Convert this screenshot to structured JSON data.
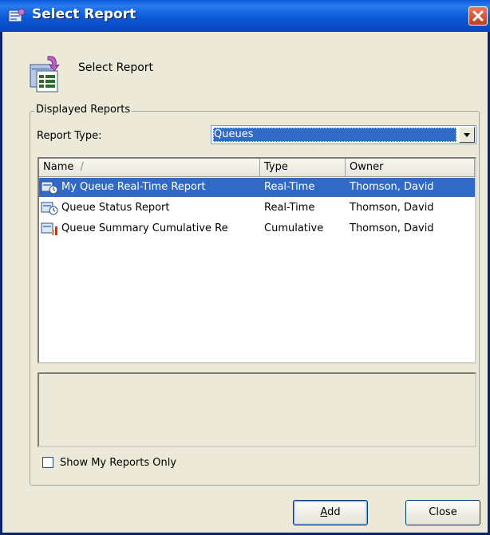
{
  "window": {
    "title": "Select Report",
    "icons": {
      "title": "report-app-icon",
      "close": "close-icon"
    }
  },
  "header": {
    "label": "Select Report",
    "icon": "report-document-icon"
  },
  "displayed_reports": {
    "legend": "Displayed Reports",
    "report_type_label": "Report Type:",
    "report_type_value": "Queues",
    "columns": [
      "Name",
      "Type",
      "Owner"
    ],
    "sort_indicator": "/",
    "rows": [
      {
        "name": "My Queue Real-Time Report",
        "type": "Real-Time",
        "owner": "Thomson, David",
        "icon": "realtime-report-icon",
        "selected": true
      },
      {
        "name": "Queue Status Report",
        "type": "Real-Time",
        "owner": "Thomson, David",
        "icon": "realtime-report-icon",
        "selected": false
      },
      {
        "name": "Queue Summary Cumulative Re",
        "type": "Cumulative",
        "owner": "Thomson, David",
        "icon": "cumulative-report-icon",
        "selected": false
      }
    ]
  },
  "show_my_reports": {
    "label": "Show My Reports Only",
    "checked": false
  },
  "buttons": {
    "add_prefix": "A",
    "add_rest": "dd",
    "close": "Close"
  },
  "colors": {
    "titlebar": "#0a5bd8",
    "selection": "#316ac5",
    "close_button": "#c4391d"
  }
}
